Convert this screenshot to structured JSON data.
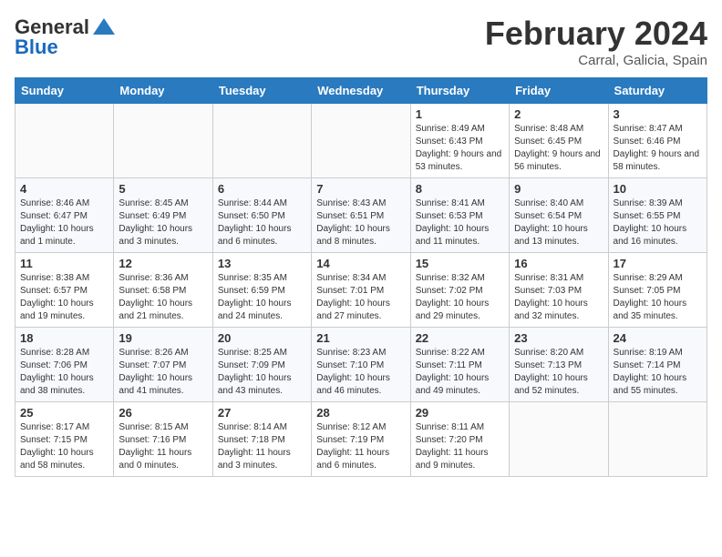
{
  "header": {
    "logo_general": "General",
    "logo_blue": "Blue",
    "title": "February 2024",
    "subtitle": "Carral, Galicia, Spain"
  },
  "weekdays": [
    "Sunday",
    "Monday",
    "Tuesday",
    "Wednesday",
    "Thursday",
    "Friday",
    "Saturday"
  ],
  "weeks": [
    [
      {
        "day": "",
        "info": ""
      },
      {
        "day": "",
        "info": ""
      },
      {
        "day": "",
        "info": ""
      },
      {
        "day": "",
        "info": ""
      },
      {
        "day": "1",
        "info": "Sunrise: 8:49 AM\nSunset: 6:43 PM\nDaylight: 9 hours\nand 53 minutes."
      },
      {
        "day": "2",
        "info": "Sunrise: 8:48 AM\nSunset: 6:45 PM\nDaylight: 9 hours\nand 56 minutes."
      },
      {
        "day": "3",
        "info": "Sunrise: 8:47 AM\nSunset: 6:46 PM\nDaylight: 9 hours\nand 58 minutes."
      }
    ],
    [
      {
        "day": "4",
        "info": "Sunrise: 8:46 AM\nSunset: 6:47 PM\nDaylight: 10 hours\nand 1 minute."
      },
      {
        "day": "5",
        "info": "Sunrise: 8:45 AM\nSunset: 6:49 PM\nDaylight: 10 hours\nand 3 minutes."
      },
      {
        "day": "6",
        "info": "Sunrise: 8:44 AM\nSunset: 6:50 PM\nDaylight: 10 hours\nand 6 minutes."
      },
      {
        "day": "7",
        "info": "Sunrise: 8:43 AM\nSunset: 6:51 PM\nDaylight: 10 hours\nand 8 minutes."
      },
      {
        "day": "8",
        "info": "Sunrise: 8:41 AM\nSunset: 6:53 PM\nDaylight: 10 hours\nand 11 minutes."
      },
      {
        "day": "9",
        "info": "Sunrise: 8:40 AM\nSunset: 6:54 PM\nDaylight: 10 hours\nand 13 minutes."
      },
      {
        "day": "10",
        "info": "Sunrise: 8:39 AM\nSunset: 6:55 PM\nDaylight: 10 hours\nand 16 minutes."
      }
    ],
    [
      {
        "day": "11",
        "info": "Sunrise: 8:38 AM\nSunset: 6:57 PM\nDaylight: 10 hours\nand 19 minutes."
      },
      {
        "day": "12",
        "info": "Sunrise: 8:36 AM\nSunset: 6:58 PM\nDaylight: 10 hours\nand 21 minutes."
      },
      {
        "day": "13",
        "info": "Sunrise: 8:35 AM\nSunset: 6:59 PM\nDaylight: 10 hours\nand 24 minutes."
      },
      {
        "day": "14",
        "info": "Sunrise: 8:34 AM\nSunset: 7:01 PM\nDaylight: 10 hours\nand 27 minutes."
      },
      {
        "day": "15",
        "info": "Sunrise: 8:32 AM\nSunset: 7:02 PM\nDaylight: 10 hours\nand 29 minutes."
      },
      {
        "day": "16",
        "info": "Sunrise: 8:31 AM\nSunset: 7:03 PM\nDaylight: 10 hours\nand 32 minutes."
      },
      {
        "day": "17",
        "info": "Sunrise: 8:29 AM\nSunset: 7:05 PM\nDaylight: 10 hours\nand 35 minutes."
      }
    ],
    [
      {
        "day": "18",
        "info": "Sunrise: 8:28 AM\nSunset: 7:06 PM\nDaylight: 10 hours\nand 38 minutes."
      },
      {
        "day": "19",
        "info": "Sunrise: 8:26 AM\nSunset: 7:07 PM\nDaylight: 10 hours\nand 41 minutes."
      },
      {
        "day": "20",
        "info": "Sunrise: 8:25 AM\nSunset: 7:09 PM\nDaylight: 10 hours\nand 43 minutes."
      },
      {
        "day": "21",
        "info": "Sunrise: 8:23 AM\nSunset: 7:10 PM\nDaylight: 10 hours\nand 46 minutes."
      },
      {
        "day": "22",
        "info": "Sunrise: 8:22 AM\nSunset: 7:11 PM\nDaylight: 10 hours\nand 49 minutes."
      },
      {
        "day": "23",
        "info": "Sunrise: 8:20 AM\nSunset: 7:13 PM\nDaylight: 10 hours\nand 52 minutes."
      },
      {
        "day": "24",
        "info": "Sunrise: 8:19 AM\nSunset: 7:14 PM\nDaylight: 10 hours\nand 55 minutes."
      }
    ],
    [
      {
        "day": "25",
        "info": "Sunrise: 8:17 AM\nSunset: 7:15 PM\nDaylight: 10 hours\nand 58 minutes."
      },
      {
        "day": "26",
        "info": "Sunrise: 8:15 AM\nSunset: 7:16 PM\nDaylight: 11 hours\nand 0 minutes."
      },
      {
        "day": "27",
        "info": "Sunrise: 8:14 AM\nSunset: 7:18 PM\nDaylight: 11 hours\nand 3 minutes."
      },
      {
        "day": "28",
        "info": "Sunrise: 8:12 AM\nSunset: 7:19 PM\nDaylight: 11 hours\nand 6 minutes."
      },
      {
        "day": "29",
        "info": "Sunrise: 8:11 AM\nSunset: 7:20 PM\nDaylight: 11 hours\nand 9 minutes."
      },
      {
        "day": "",
        "info": ""
      },
      {
        "day": "",
        "info": ""
      }
    ]
  ]
}
